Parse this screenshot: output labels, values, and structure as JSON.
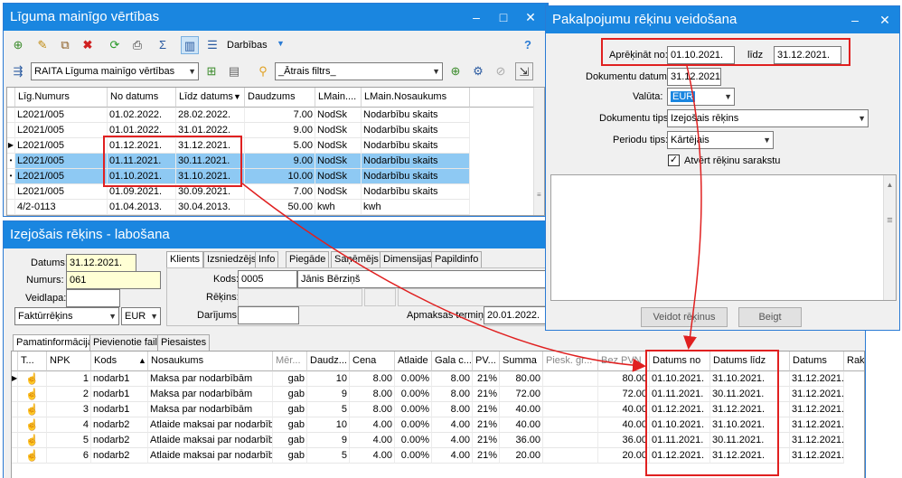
{
  "win_values": {
    "title": "Līguma mainīgo vērtības",
    "toolbar": {
      "actions_label": "Darbības"
    },
    "filter": {
      "catalog_value": "RAITA Līguma mainīgo vērtības",
      "quick_filter_value": "_Ātrais filtrs_"
    },
    "columns": [
      "Līg.Numurs",
      "No datums",
      "Līdz datums",
      "Daudzums",
      "LMain....",
      "LMain.Nosaukums"
    ],
    "rows": [
      [
        "L2021/005",
        "01.02.2022.",
        "28.02.2022.",
        "7.00",
        "NodSk",
        "Nodarbību skaits"
      ],
      [
        "L2021/005",
        "01.01.2022.",
        "31.01.2022.",
        "9.00",
        "NodSk",
        "Nodarbību skaits"
      ],
      [
        "L2021/005",
        "01.12.2021.",
        "31.12.2021.",
        "5.00",
        "NodSk",
        "Nodarbību skaits"
      ],
      [
        "L2021/005",
        "01.11.2021.",
        "30.11.2021.",
        "9.00",
        "NodSk",
        "Nodarbību skaits"
      ],
      [
        "L2021/005",
        "01.10.2021.",
        "31.10.2021.",
        "10.00",
        "NodSk",
        "Nodarbību skaits"
      ],
      [
        "L2021/005",
        "01.09.2021.",
        "30.09.2021.",
        "7.00",
        "NodSk",
        "Nodarbību skaits"
      ],
      [
        "4/2-0113",
        "01.04.2013.",
        "30.04.2013.",
        "50.00",
        "kwh",
        "kwh"
      ]
    ]
  },
  "win_invoice": {
    "title": "Izejošais rēķins - labošana",
    "datums_label": "Datums:",
    "datums_value": "31.12.2021.",
    "numurs_label": "Numurs:",
    "numurs_value": "061",
    "veidlapa_label": "Veidlapa:",
    "veidlapa_value": "",
    "doc_type_value": "Faktūrrēķins",
    "currency_value": "EUR",
    "client_tabs": [
      "Klients",
      "Izsniedzējs",
      "Info",
      "Piegāde",
      "Saņēmējs",
      "Dimensijas",
      "Papildinfo"
    ],
    "kods_label": "Kods:",
    "kods_value": "0005",
    "client_name": "Jānis Bērziņš",
    "rekins_label": "Rēķins:",
    "darijums_label": "Darījums:",
    "apmaksas_label": "Apmaksas termiņš:",
    "apmaksas_value": "20.01.2022.",
    "main_tabs": [
      "Pamatinformācija",
      "Pievienotie faili",
      "Piesaistes"
    ],
    "columns": [
      "T...",
      "NPK",
      "Kods",
      "Nosaukums",
      "Mēr...",
      "Daudz...",
      "Cena",
      "Atlaide",
      "Gala c...",
      "PV...",
      "Summa",
      "Piesk. gr...",
      "Bez PVN",
      "Datums no",
      "Datums līdz",
      "Datums",
      "Rak"
    ],
    "rows": [
      [
        "1",
        "nodarb1",
        "Maksa par nodarbībām",
        "gab",
        "10",
        "8.00",
        "0.00%",
        "8.00",
        "21%",
        "80.00",
        "80.00",
        "01.10.2021.",
        "31.10.2021.",
        "31.12.2021."
      ],
      [
        "2",
        "nodarb1",
        "Maksa par nodarbībām",
        "gab",
        "9",
        "8.00",
        "0.00%",
        "8.00",
        "21%",
        "72.00",
        "72.00",
        "01.11.2021.",
        "30.11.2021.",
        "31.12.2021."
      ],
      [
        "3",
        "nodarb1",
        "Maksa par nodarbībām",
        "gab",
        "5",
        "8.00",
        "0.00%",
        "8.00",
        "21%",
        "40.00",
        "40.00",
        "01.12.2021.",
        "31.12.2021.",
        "31.12.2021."
      ],
      [
        "4",
        "nodarb2",
        "Atlaide maksai par nodarbībām",
        "gab",
        "10",
        "4.00",
        "0.00%",
        "4.00",
        "21%",
        "40.00",
        "40.00",
        "01.10.2021.",
        "31.10.2021.",
        "31.12.2021."
      ],
      [
        "5",
        "nodarb2",
        "Atlaide maksai par nodarbībām",
        "gab",
        "9",
        "4.00",
        "0.00%",
        "4.00",
        "21%",
        "36.00",
        "36.00",
        "01.11.2021.",
        "30.11.2021.",
        "31.12.2021."
      ],
      [
        "6",
        "nodarb2",
        "Atlaide maksai par nodarbībām",
        "gab",
        "5",
        "4.00",
        "0.00%",
        "4.00",
        "21%",
        "20.00",
        "20.00",
        "01.12.2021.",
        "31.12.2021.",
        "31.12.2021."
      ]
    ]
  },
  "win_service": {
    "title": "Pakalpojumu rēķinu veidošana",
    "calc_label": "Aprēķināt no:",
    "calc_from": "01.10.2021.",
    "calc_to_label": "līdz",
    "calc_to": "31.12.2021.",
    "doc_date_label": "Dokumentu datums:",
    "doc_date_value": "31.12.2021.",
    "currency_label": "Valūta:",
    "currency_value": "EUR",
    "doc_type_label": "Dokumentu tips:",
    "doc_type_value": "Izejošais rēķins",
    "period_label": "Periodu tips:",
    "period_value": "Kārtējais",
    "open_list_label": "Atvērt rēķinu sarakstu",
    "create_button": "Veidot rēķinus",
    "close_button": "Beigt"
  },
  "colors": {
    "titlebar": "#1a86e0",
    "highlight": "#e02020",
    "selection": "#8ec9f3"
  }
}
